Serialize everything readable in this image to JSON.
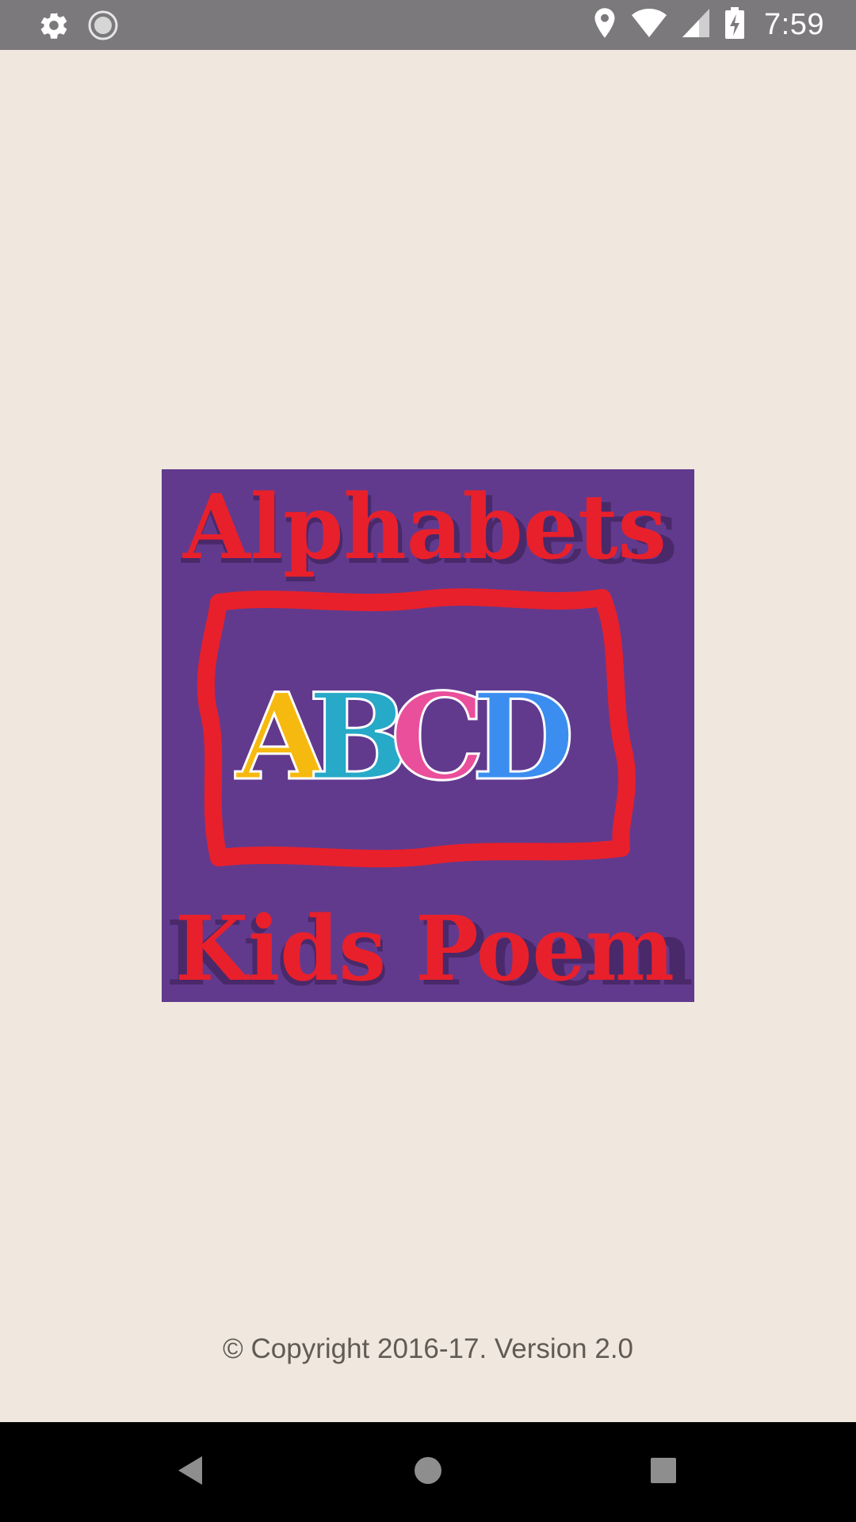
{
  "status_bar": {
    "time": "7:59",
    "icons_left": [
      "gear-icon",
      "sync-icon"
    ],
    "icons_right": [
      "location-icon",
      "wifi-icon",
      "signal-icon",
      "battery-charging-icon"
    ],
    "background": "#7b797c"
  },
  "splash": {
    "logo": {
      "top_text": "Alphabets",
      "letters": [
        "A",
        "B",
        "C",
        "D"
      ],
      "letter_colors": [
        "#f6b90f",
        "#27a9c8",
        "#ea4f9b",
        "#3b8ef0"
      ],
      "bottom_text": "Kids Poem",
      "background": "#613a8e",
      "accent": "#e8202b"
    }
  },
  "footer": {
    "copyright": "© Copyright 2016-17. Version 2.0"
  },
  "nav_bar": {
    "buttons": [
      "back-icon",
      "home-icon",
      "recents-icon"
    ]
  },
  "colors": {
    "page_background": "#f0e8de",
    "copyright_text": "#615a55"
  }
}
